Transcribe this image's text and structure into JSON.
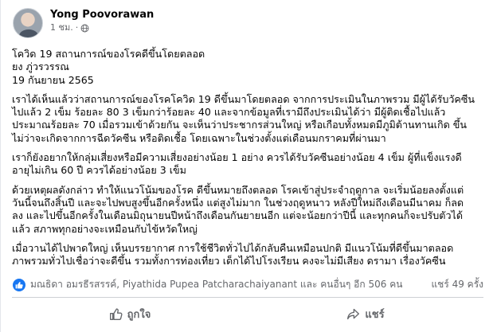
{
  "post": {
    "author": "Yong Poovorawan",
    "timestamp": "1 ชม.",
    "privacy_icon": "globe-icon",
    "paragraphs": [
      [
        "โควิด 19  สถานการณ์ของโรคดีขึ้นโดยตลอด",
        "ยง ภู่วรวรรณ",
        "19 กันยายน 2565"
      ],
      [
        "เราได้เห็นแล้วว่าสถานการณ์ของโรคโควิด 19  ดีขึ้นมาโดยตลอด จากการประเมินในภาพรวม มีผู้ได้รับวัคซีน",
        "ไปแล้ว 2 เข็ม ร้อยละ 80  3 เข็มกว่าร้อยละ 40  และจากข้อมูลที่เรามีถึงประเมินได้ว่า มีผู้ติดเชื้อไปแล้ว",
        "ประมาณร้อยละ 70  เมื่อรวมเข้าด้วยกัน จะเห็นว่าประชากรส่วนใหญ่ หรือเกือบทั้งหมดมีภูมิต้านทานเกิด ขึ้น",
        "ไม่ว่าจะเกิดจากการฉีดวัคซีน หรือติดเชื้อ โดยเฉพาะในช่วงตั้งแต่เดือนมกราคมที่ผ่านมา"
      ],
      [
        "เราก็ยังอยากให้กลุ่มเสี่ยงหรือมีความเสี่ยงอย่างน้อย 1 อย่าง ควรได้รับวัคซีนอย่างน้อย 4 เข็ม ผู้ที่แข็งแรงดี",
        "อายุไม่เกิน  60 ปี ควรได้อย่างน้อย 3 เข็ม"
      ],
      [
        "ด้วยเหตุผลดังกล่าว ทำให้แนวโน้มของโรค ดีขึ้นหมายถึงตลอด โรคเข้าสู่ประจำฤดูกาล จะเริ่มน้อยลงตั้งแต่",
        "วันนี้จนถึงสิ้นปี และจะไปพบสูงขึ้นอีกครั้งหนึ่ง แต่สูงไม่มาก ในช่วงฤดูหนาว หลังปีใหม่ถึงเดือนมีนาคม ก็ลด",
        "ลง และไปขึ้นอีกครั้งในเดือนมิถุนายนปีหน้าถึงเดือนกันยายนอีก แต่จะน้อยกว่าปีนี้ และทุกคนก็จะปรับตัวได้",
        "แล้ว สภาพทุกอย่างจะเหมือนกับไข้หวัดใหญ่"
      ],
      [
        "เมื่อวานได้ไปพาดใหญ่ เห็นบรรยากาศ การใช้ชีวิตทั่วไปได้กลับคืนเหมือนปกติ มีแนวโน้มที่ดีขึ้นมาตลอด",
        "ภาพรวมทั่วไปเชื่อว่าจะดีขึ้น รวมทั้งการท่องเที่ยว เด็กได้ไปโรงเรียน คงจะไม่มีเสียง ดรามา เรื่องวัคซีน"
      ]
    ]
  },
  "stats": {
    "reaction_icon": "like-icon",
    "reactions_text": "มณธิดา อมรธีรสรรค์, Piyathida Pupea Patcharachaiyanant และ คนอื่นๆ อีก 506 คน",
    "shares_text": "แชร์ 49 ครั้ง"
  },
  "actions": {
    "like_label": "ถูกใจ",
    "share_label": "แชร์"
  },
  "colors": {
    "accent": "#1877f2",
    "secondary_text": "#65676b",
    "divider": "#ced0d4"
  }
}
